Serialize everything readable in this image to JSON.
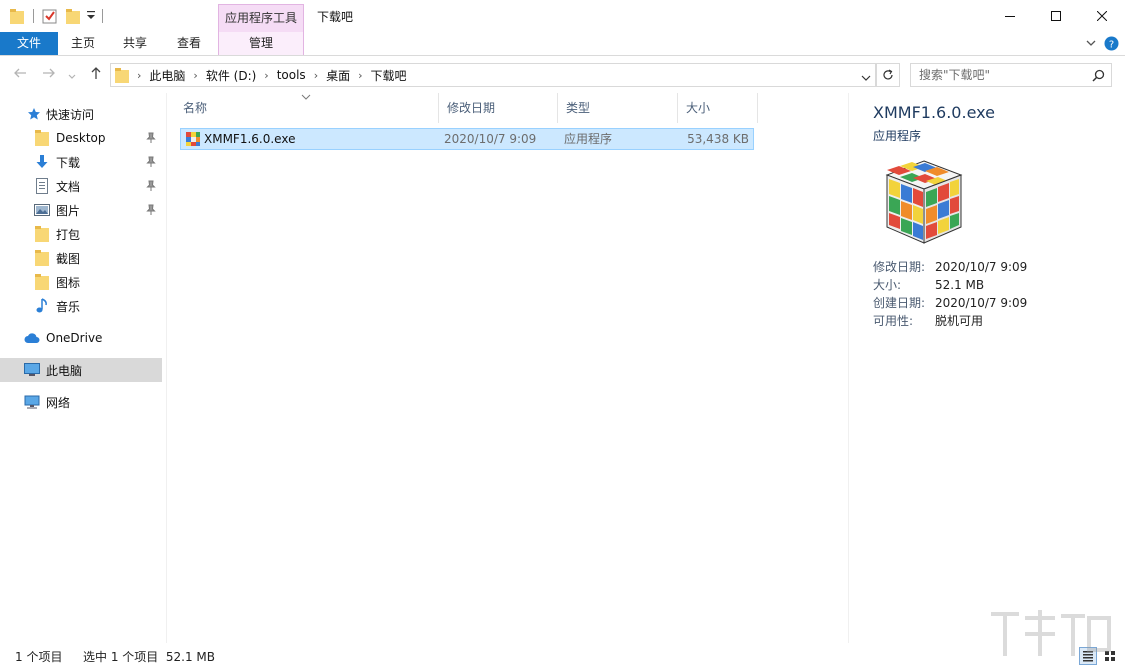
{
  "window": {
    "title": "下载吧",
    "contextual_tab_title": "应用程序工具"
  },
  "ribbon": {
    "tabs": [
      {
        "label": "文件"
      },
      {
        "label": "主页"
      },
      {
        "label": "共享"
      },
      {
        "label": "查看"
      },
      {
        "label": "管理"
      }
    ]
  },
  "address": {
    "crumbs": [
      "此电脑",
      "软件 (D:)",
      "tools",
      "桌面",
      "下载吧"
    ]
  },
  "search": {
    "placeholder": "搜索\"下载吧\""
  },
  "nav": {
    "quick_access": "快速访问",
    "items": [
      {
        "label": "Desktop",
        "icon": "folder-icon",
        "pinned": true
      },
      {
        "label": "下载",
        "icon": "download-arrow-icon",
        "pinned": true
      },
      {
        "label": "文档",
        "icon": "document-icon",
        "pinned": true
      },
      {
        "label": "图片",
        "icon": "picture-icon",
        "pinned": true
      },
      {
        "label": "打包",
        "icon": "folder-icon",
        "pinned": false
      },
      {
        "label": "截图",
        "icon": "folder-icon",
        "pinned": false
      },
      {
        "label": "图标",
        "icon": "folder-icon",
        "pinned": false
      },
      {
        "label": "音乐",
        "icon": "music-icon",
        "pinned": false
      }
    ],
    "onedrive": "OneDrive",
    "this_pc": "此电脑",
    "network": "网络"
  },
  "columns": {
    "name": "名称",
    "modified": "修改日期",
    "type": "类型",
    "size": "大小"
  },
  "files": [
    {
      "name": "XMMF1.6.0.exe",
      "modified": "2020/10/7 9:09",
      "type": "应用程序",
      "size": "53,438 KB"
    }
  ],
  "preview": {
    "title": "XMMF1.6.0.exe",
    "type": "应用程序",
    "details": [
      {
        "key": "修改日期:",
        "value": "2020/10/7 9:09"
      },
      {
        "key": "大小:",
        "value": "52.1 MB"
      },
      {
        "key": "创建日期:",
        "value": "2020/10/7 9:09"
      },
      {
        "key": "可用性:",
        "value": "脱机可用"
      }
    ]
  },
  "status": {
    "count": "1 个项目",
    "selected": "选中 1 个项目  52.1 MB"
  },
  "colors": {
    "file_tab": "#1979ca",
    "contextual": "#f5dcf5",
    "selection": "#cce8ff"
  }
}
